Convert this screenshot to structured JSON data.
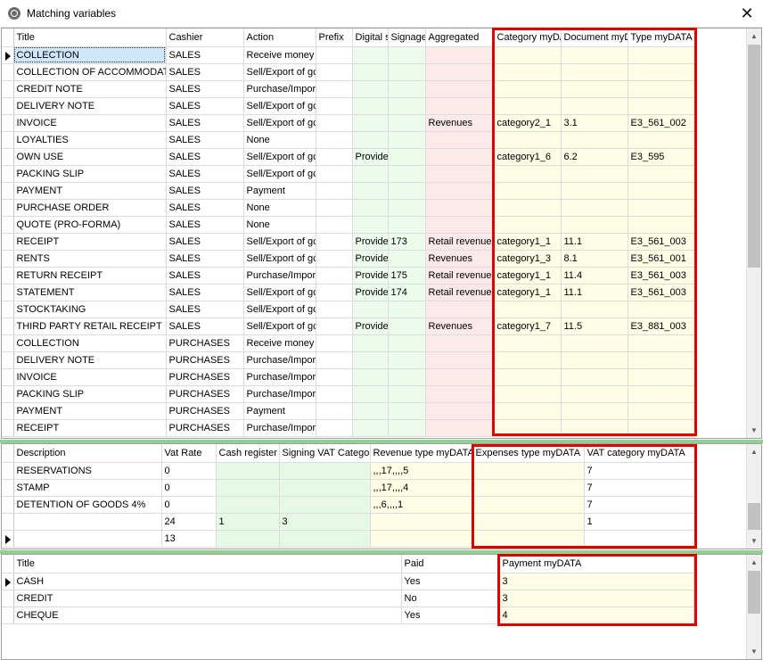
{
  "window": {
    "title": "Matching variables",
    "close_glyph": "✕"
  },
  "icons": {
    "app": "app-icon",
    "close": "close-icon",
    "row_pointer": "row-pointer-icon"
  },
  "colors": {
    "highlight": "#e00000",
    "splitter": "#8fd18f",
    "green_cell": "#ecfbec",
    "pink_cell": "#fde9e9",
    "yellow_cell": "#fffde6"
  },
  "grid1": {
    "columns": [
      "Title",
      "Cashier",
      "Action",
      "Prefix",
      "Digital s",
      "Signage",
      "Aggregated",
      "Category myDA",
      "Document myD",
      "Type myDATA"
    ],
    "rows": [
      [
        "COLLECTION",
        "SALES",
        "Receive money",
        "",
        "",
        "",
        "",
        "",
        "",
        ""
      ],
      [
        "COLLECTION OF ACCOMMODATIO",
        "SALES",
        "Sell/Export of gc",
        "",
        "",
        "",
        "",
        "",
        "",
        ""
      ],
      [
        "CREDIT NOTE",
        "SALES",
        "Purchase/Import",
        "",
        "",
        "",
        "",
        "",
        "",
        ""
      ],
      [
        "DELIVERY NOTE",
        "SALES",
        "Sell/Export of gc",
        "",
        "",
        "",
        "",
        "",
        "",
        ""
      ],
      [
        "INVOICE",
        "SALES",
        "Sell/Export of gc",
        "",
        "",
        "",
        "Revenues",
        "category2_1",
        "3.1",
        "E3_561_002"
      ],
      [
        "LOYALTIES",
        "SALES",
        "None",
        "",
        "",
        "",
        "",
        "",
        "",
        ""
      ],
      [
        "OWN USE",
        "SALES",
        "Sell/Export of gc",
        "",
        "Provide",
        "",
        "",
        "category1_6",
        "6.2",
        "E3_595"
      ],
      [
        "PACKING SLIP",
        "SALES",
        "Sell/Export of gc",
        "",
        "",
        "",
        "",
        "",
        "",
        ""
      ],
      [
        "PAYMENT",
        "SALES",
        "Payment",
        "",
        "",
        "",
        "",
        "",
        "",
        ""
      ],
      [
        "PURCHASE ORDER",
        "SALES",
        "None",
        "",
        "",
        "",
        "",
        "",
        "",
        ""
      ],
      [
        "QUOTE (PRO-FORMA)",
        "SALES",
        "None",
        "",
        "",
        "",
        "",
        "",
        "",
        ""
      ],
      [
        "RECEIPT",
        "SALES",
        "Sell/Export of gc",
        "",
        "Provide",
        "173",
        "Retail revenues",
        "category1_1",
        "11.1",
        "E3_561_003"
      ],
      [
        "RENTS",
        "SALES",
        "Sell/Export of gc",
        "",
        "Provide",
        "",
        "Revenues",
        "category1_3",
        "8.1",
        "E3_561_001"
      ],
      [
        "RETURN RECEIPT",
        "SALES",
        "Purchase/Import",
        "",
        "Provide",
        "175",
        "Retail revenues",
        "category1_1",
        "11.4",
        "E3_561_003"
      ],
      [
        "STATEMENT",
        "SALES",
        "Sell/Export of gc",
        "",
        "Provide",
        "174",
        "Retail revenues",
        "category1_1",
        "11.1",
        "E3_561_003"
      ],
      [
        "STOCKTAKING",
        "SALES",
        "Sell/Export of gc",
        "",
        "",
        "",
        "",
        "",
        "",
        ""
      ],
      [
        "THIRD PARTY RETAIL RECEIPT",
        "SALES",
        "Sell/Export of gc",
        "",
        "Provide",
        "",
        "Revenues",
        "category1_7",
        "11.5",
        "E3_881_003"
      ],
      [
        "COLLECTION",
        "PURCHASES",
        "Receive money",
        "",
        "",
        "",
        "",
        "",
        "",
        ""
      ],
      [
        "DELIVERY NOTE",
        "PURCHASES",
        "Purchase/Import",
        "",
        "",
        "",
        "",
        "",
        "",
        ""
      ],
      [
        "INVOICE",
        "PURCHASES",
        "Purchase/Import",
        "",
        "",
        "",
        "",
        "",
        "",
        ""
      ],
      [
        "PACKING SLIP",
        "PURCHASES",
        "Purchase/Import",
        "",
        "",
        "",
        "",
        "",
        "",
        ""
      ],
      [
        "PAYMENT",
        "PURCHASES",
        "Payment",
        "",
        "",
        "",
        "",
        "",
        "",
        ""
      ],
      [
        "RECEIPT",
        "PURCHASES",
        "Purchase/Import",
        "",
        "",
        "",
        "",
        "",
        "",
        ""
      ]
    ]
  },
  "grid2": {
    "columns": [
      "Description",
      "Vat Rate",
      "Cash register",
      "Signing VAT Catego",
      "Revenue type myDATA",
      "Expenses type myDATA",
      "VAT category myDATA"
    ],
    "rows": [
      [
        "RESERVATIONS",
        "0",
        "",
        "",
        ",,,17,,,,5",
        "",
        "7"
      ],
      [
        "STAMP",
        "0",
        "",
        "",
        ",,,17,,,,4",
        "",
        "7"
      ],
      [
        "DETENTION OF GOODS 4%",
        "0",
        "",
        "",
        ",,,6,,,,1",
        "",
        "7"
      ],
      [
        "",
        "24",
        "1",
        "3",
        "",
        "",
        "1"
      ],
      [
        "",
        "13",
        "",
        "",
        "",
        "",
        ""
      ]
    ]
  },
  "grid3": {
    "columns": [
      "Title",
      "Paid",
      "Payment myDATA"
    ],
    "rows": [
      [
        "CASH",
        "Yes",
        "3"
      ],
      [
        "CREDIT",
        "No",
        "3"
      ],
      [
        "CHEQUE",
        "Yes",
        "4"
      ]
    ]
  }
}
